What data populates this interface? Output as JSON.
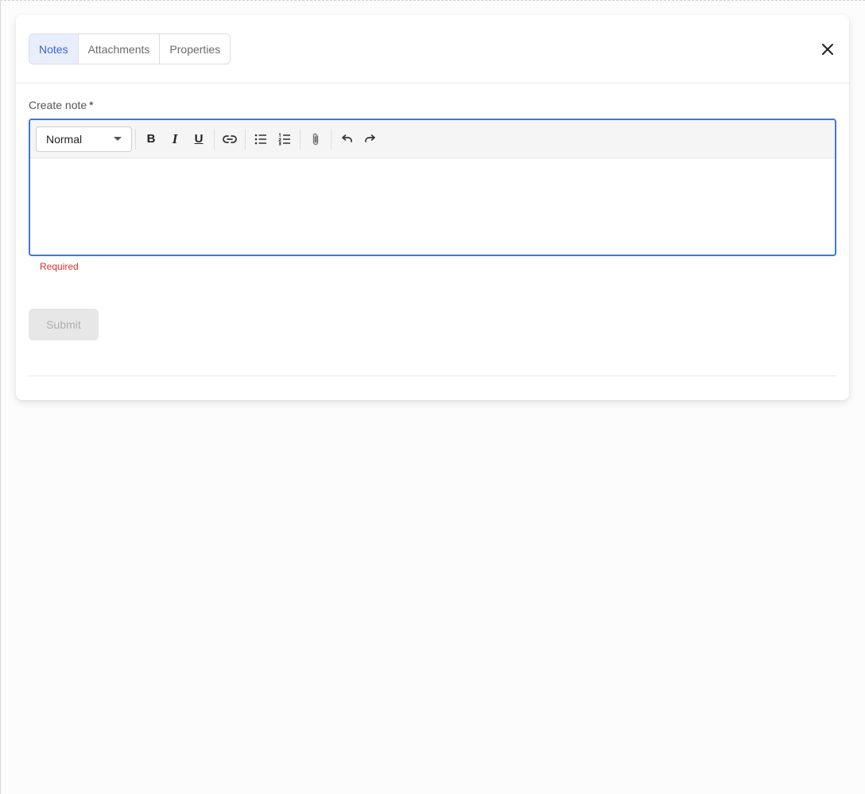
{
  "tabs": [
    {
      "label": "Notes",
      "active": true
    },
    {
      "label": "Attachments",
      "active": false
    },
    {
      "label": "Properties",
      "active": false
    }
  ],
  "form": {
    "label": "Create note",
    "required_mark": "*",
    "error": "Required",
    "submit_label": "Submit"
  },
  "toolbar": {
    "format_select": "Normal",
    "bold": "B",
    "italic": "I",
    "underline": "U",
    "icons": [
      "link-icon",
      "bullet-list-icon",
      "numbered-list-icon",
      "attach-icon",
      "undo-icon",
      "redo-icon"
    ]
  },
  "colors": {
    "accent": "#3f78d6",
    "active_tab_bg": "#e8eefc",
    "active_tab_text": "#3a64d8",
    "error": "#d93025"
  }
}
